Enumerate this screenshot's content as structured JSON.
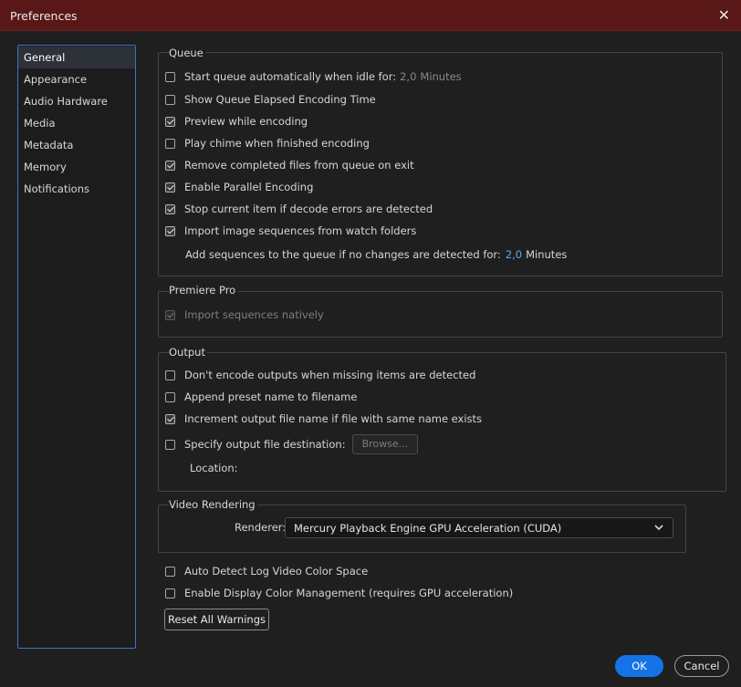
{
  "window": {
    "title": "Preferences",
    "close_glyph": "✕"
  },
  "sidebar": {
    "items": [
      {
        "label": "General",
        "selected": true
      },
      {
        "label": "Appearance"
      },
      {
        "label": "Audio Hardware"
      },
      {
        "label": "Media"
      },
      {
        "label": "Metadata"
      },
      {
        "label": "Memory"
      },
      {
        "label": "Notifications"
      }
    ]
  },
  "queue": {
    "title": "Queue",
    "start_auto": {
      "label": "Start queue automatically when idle for:",
      "checked": false,
      "value": "2,0",
      "unit": "Minutes"
    },
    "show_elapsed": {
      "label": "Show Queue Elapsed Encoding Time",
      "checked": false
    },
    "preview_encoding": {
      "label": "Preview while encoding",
      "checked": true
    },
    "play_chime": {
      "label": "Play chime when finished encoding",
      "checked": false
    },
    "remove_completed": {
      "label": "Remove completed files from queue on exit",
      "checked": true
    },
    "parallel_encoding": {
      "label": "Enable Parallel Encoding",
      "checked": true
    },
    "stop_decode_errors": {
      "label": "Stop current item if decode errors are detected",
      "checked": true
    },
    "import_watch": {
      "label": "Import image sequences from watch folders",
      "checked": true
    },
    "add_sequences": {
      "label": "Add sequences to the queue if no changes are detected for:",
      "value": "2,0",
      "unit": "Minutes"
    }
  },
  "premiere": {
    "title": "Premiere Pro",
    "import_natively": {
      "label": "Import sequences natively",
      "checked": true,
      "disabled": true
    }
  },
  "output": {
    "title": "Output",
    "dont_encode_missing": {
      "label": "Don't encode outputs when missing items are detected",
      "checked": false
    },
    "append_preset": {
      "label": "Append preset name to filename",
      "checked": false
    },
    "increment_name": {
      "label": "Increment output file name if file with same name exists",
      "checked": true
    },
    "specify_destination": {
      "label": "Specify output file destination:",
      "checked": false
    },
    "browse_label": "Browse...",
    "location_label": "Location:"
  },
  "video_rendering": {
    "title": "Video Rendering",
    "renderer_label": "Renderer:",
    "renderer_value": "Mercury Playback Engine GPU Acceleration (CUDA)"
  },
  "misc": {
    "auto_detect_log": {
      "label": "Auto Detect Log Video Color Space",
      "checked": false
    },
    "display_color_mgmt": {
      "label": "Enable Display Color Management (requires GPU acceleration)",
      "checked": false
    }
  },
  "buttons": {
    "reset_warnings": "Reset All Warnings",
    "ok": "OK",
    "cancel": "Cancel"
  },
  "colors": {
    "titlebar": "#5a1717",
    "accent": "#1473e6",
    "sidebar_border": "#3d74c2",
    "value_blue": "#5fa8ee"
  }
}
